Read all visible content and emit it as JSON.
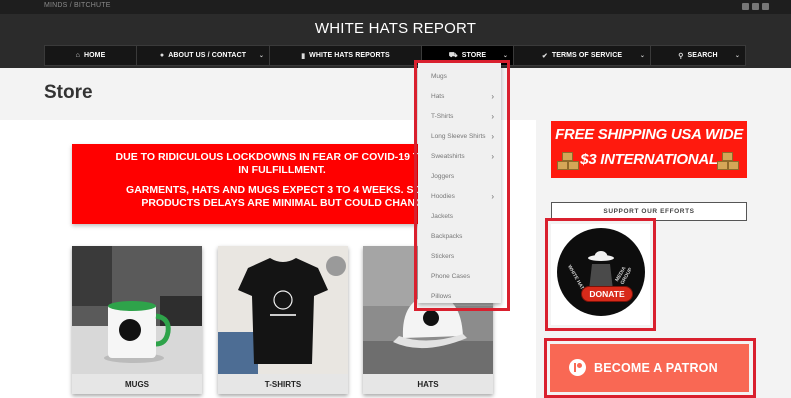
{
  "topbar": {
    "crumb": "MINDS / BITCHUTE"
  },
  "header": {
    "site_title": "WHITE HATS REPORT"
  },
  "nav": [
    {
      "icon": "home-icon",
      "glyph": "⌂",
      "label": "HOME",
      "caret": ""
    },
    {
      "icon": "user-icon",
      "glyph": "●",
      "label": "ABOUT US / CONTACT",
      "caret": "⌄"
    },
    {
      "icon": "bookmark-icon",
      "glyph": "▮",
      "label": "WHITE HATS REPORTS",
      "caret": ""
    },
    {
      "icon": "cart-icon",
      "glyph": "⛟",
      "label": "STORE",
      "caret": "⌄"
    },
    {
      "icon": "check-icon",
      "glyph": "✔",
      "label": "TERMS OF SERVICE",
      "caret": "⌄"
    },
    {
      "icon": "search-icon",
      "glyph": "⚲",
      "label": "SEARCH",
      "caret": "⌄"
    }
  ],
  "page": {
    "title": "Store"
  },
  "notice": {
    "line1": "DUE TO RIDICULOUS LOCKDOWNS IN FEAR OF COVID-19 THERE",
    "line2": "IN FULFILLMENT.",
    "line3": "GARMENTS, HATS AND MUGS EXPECT 3 TO 4 WEEKS. SO FA",
    "line4": "PRODUCTS DELAYS ARE MINIMAL BUT COULD CHANC"
  },
  "products": [
    {
      "label": "MUGS"
    },
    {
      "label": "T-SHIRTS"
    },
    {
      "label": "HATS"
    }
  ],
  "dropdown": [
    {
      "label": "Mugs",
      "has_sub": false
    },
    {
      "label": "Hats",
      "has_sub": true
    },
    {
      "label": "T-Shirts",
      "has_sub": true
    },
    {
      "label": "Long Sleeve Shirts",
      "has_sub": true
    },
    {
      "label": "Sweatshirts",
      "has_sub": true
    },
    {
      "label": "Joggers",
      "has_sub": false
    },
    {
      "label": "Hoodies",
      "has_sub": true
    },
    {
      "label": "Jackets",
      "has_sub": false
    },
    {
      "label": "Backpacks",
      "has_sub": false
    },
    {
      "label": "Stickers",
      "has_sub": false
    },
    {
      "label": "Phone Cases",
      "has_sub": false
    },
    {
      "label": "Pillows",
      "has_sub": false
    }
  ],
  "sidebar": {
    "shipping_line1": "FREE SHIPPING USA WIDE",
    "shipping_line2": "$3 INTERNATIONAL",
    "support_title": "SUPPORT OUR EFFORTS",
    "donate_label": "DONATE",
    "donate_ring_left": "WHITE HATS",
    "donate_ring_right": "MEDIA GROUP",
    "patron_label": "BECOME A PATRON"
  },
  "colors": {
    "highlight": "#d9202e",
    "notice": "#ff0000",
    "patron": "#f96854"
  }
}
